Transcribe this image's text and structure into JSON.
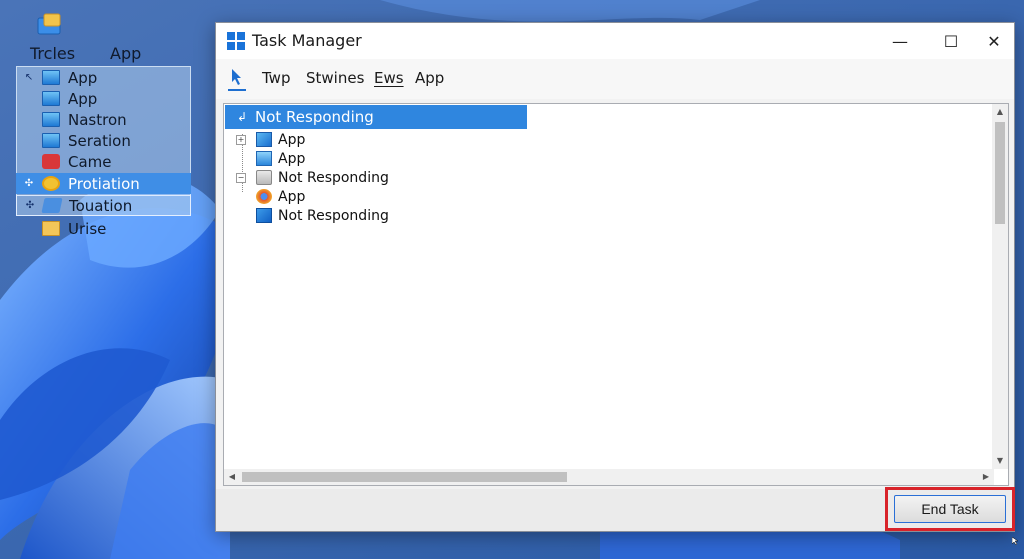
{
  "colors": {
    "selection": "#2f86df",
    "highlight_border": "#d8232a",
    "window_bg": "#f2f2f2"
  },
  "desktop": {
    "icon": "desktop-app-icon",
    "header": [
      "Trcles",
      "App"
    ],
    "items": [
      {
        "indicator": "↖",
        "icon": "monitor-icon",
        "label": "App",
        "selected": false
      },
      {
        "indicator": "",
        "icon": "monitor-icon",
        "label": "App",
        "selected": false
      },
      {
        "indicator": "",
        "icon": "monitor-icon",
        "label": "Nastron",
        "selected": false
      },
      {
        "indicator": "",
        "icon": "monitor-icon",
        "label": "Seration",
        "selected": false
      },
      {
        "indicator": "",
        "icon": "game-icon",
        "label": "Came",
        "selected": false
      },
      {
        "indicator": "✣",
        "icon": "gear-icon",
        "label": "Protiation",
        "selected": true
      },
      {
        "indicator": "✣",
        "icon": "tool-icon",
        "label": "Touation",
        "selected": false
      },
      {
        "indicator": "",
        "icon": "folder-icon",
        "label": "Urise",
        "selected": false
      }
    ]
  },
  "window": {
    "title": "Task Manager",
    "controls": {
      "minimize": "—",
      "maximize": "☐",
      "close": "✕"
    },
    "menu": [
      "Twp",
      "Stwines",
      "Ews",
      "App"
    ],
    "list": {
      "selected_row": "Not Responding",
      "rows": [
        {
          "expand": "+",
          "icon": "app-icon",
          "label": "App"
        },
        {
          "expand": "",
          "icon": "monitor-icon",
          "label": "App"
        },
        {
          "expand": "−",
          "icon": "drive-icon",
          "label": "Not Responding"
        },
        {
          "expand": "",
          "icon": "chrome-icon",
          "label": "App"
        },
        {
          "expand": "",
          "icon": "windows-app-icon",
          "label": "Not Responding"
        }
      ]
    },
    "end_task_label": "End Task"
  }
}
